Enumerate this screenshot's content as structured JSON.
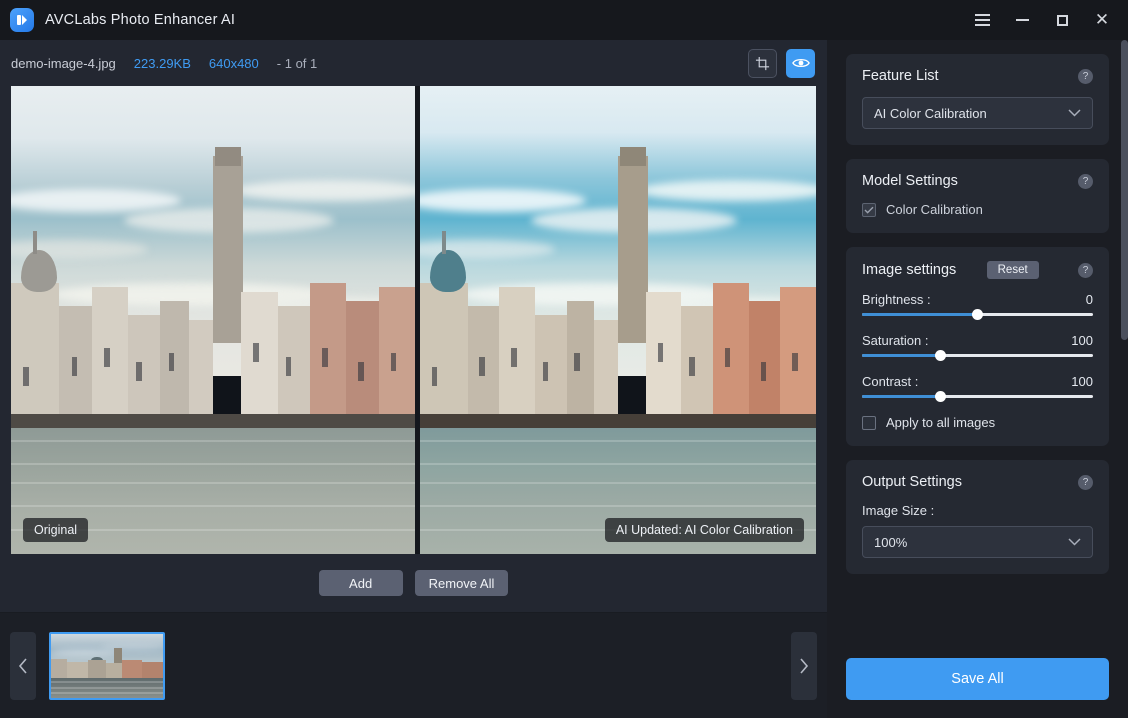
{
  "window": {
    "title": "AVCLabs Photo Enhancer AI",
    "menu_icon": "hamburger-icon",
    "minimize_label": "Minimize",
    "maximize_label": "Maximize",
    "close_label": "Close"
  },
  "file_info": {
    "name": "demo-image-4.jpg",
    "size": "223.29KB",
    "dimensions": "640x480",
    "counter": "- 1 of 1",
    "crop_icon": "crop-icon",
    "preview_icon": "eye-icon"
  },
  "preview": {
    "original_badge": "Original",
    "enhanced_badge": "AI Updated: AI Color Calibration"
  },
  "toolbar": {
    "add_label": "Add",
    "remove_all_label": "Remove All",
    "prev_icon": "chevron-left-icon",
    "next_icon": "chevron-right-icon"
  },
  "thumbnails": [
    {
      "name": "demo-image-4.jpg",
      "selected": true
    }
  ],
  "feature_list": {
    "title": "Feature List",
    "help": "?",
    "selected": "AI Color Calibration",
    "chevron": "⌄",
    "options": [
      "AI Color Calibration"
    ]
  },
  "model_settings": {
    "title": "Model Settings",
    "help": "?",
    "checkbox_label": "Color Calibration",
    "checkbox_checked": true,
    "check_glyph": "✓"
  },
  "image_settings": {
    "title": "Image settings",
    "reset_label": "Reset",
    "help": "?",
    "sliders": [
      {
        "label": "Brightness :",
        "value": "0",
        "percent": 50
      },
      {
        "label": "Saturation :",
        "value": "100",
        "percent": 34
      },
      {
        "label": "Contrast :",
        "value": "100",
        "percent": 34
      }
    ],
    "apply_all_label": "Apply to all images",
    "apply_all_checked": false
  },
  "output_settings": {
    "title": "Output Settings",
    "help": "?",
    "image_size_label": "Image Size :",
    "image_size_value": "100%",
    "chevron": "⌄",
    "options": [
      "100%"
    ]
  },
  "footer": {
    "save_all_label": "Save All"
  },
  "colors": {
    "accent": "#3f9bf2",
    "panel_bg": "#1b1d23",
    "card_bg": "#252932",
    "workspace_bg": "#232731",
    "button_gray": "#5b6172",
    "slider_fill": "#3f8fd6"
  }
}
